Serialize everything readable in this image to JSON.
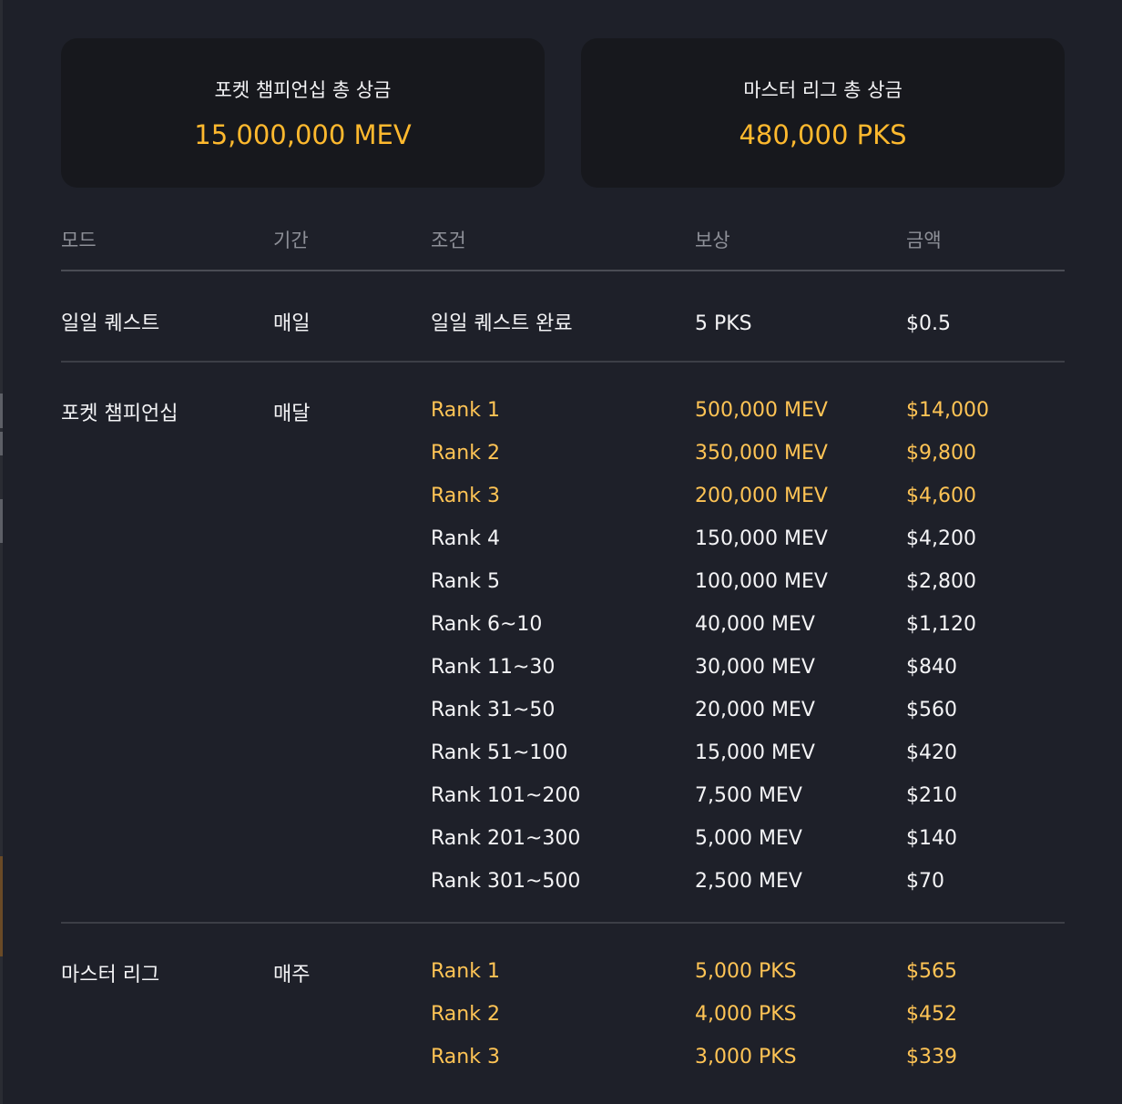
{
  "summary": {
    "cards": [
      {
        "title": "포켓 챔피언십 총 상금",
        "value": "15,000,000 MEV"
      },
      {
        "title": "마스터 리그 총 상금",
        "value": "480,000 PKS"
      }
    ]
  },
  "table": {
    "headers": {
      "mode": "모드",
      "period": "기간",
      "condition": "조건",
      "reward": "보상",
      "amount": "금액"
    },
    "groups": [
      {
        "mode": "일일 퀘스트",
        "period": "매일",
        "rows": [
          {
            "condition": "일일 퀘스트 완료",
            "reward": "5 PKS",
            "amount": "$0.5",
            "highlight": false
          }
        ]
      },
      {
        "mode": "포켓 챔피언십",
        "period": "매달",
        "rows": [
          {
            "condition": "Rank 1",
            "reward": "500,000 MEV",
            "amount": "$14,000",
            "highlight": true
          },
          {
            "condition": "Rank 2",
            "reward": "350,000 MEV",
            "amount": "$9,800",
            "highlight": true
          },
          {
            "condition": "Rank 3",
            "reward": "200,000 MEV",
            "amount": "$4,600",
            "highlight": true
          },
          {
            "condition": "Rank 4",
            "reward": "150,000 MEV",
            "amount": "$4,200",
            "highlight": false
          },
          {
            "condition": "Rank 5",
            "reward": "100,000 MEV",
            "amount": "$2,800",
            "highlight": false
          },
          {
            "condition": "Rank 6~10",
            "reward": "40,000 MEV",
            "amount": "$1,120",
            "highlight": false
          },
          {
            "condition": "Rank 11~30",
            "reward": "30,000 MEV",
            "amount": "$840",
            "highlight": false
          },
          {
            "condition": "Rank 31~50",
            "reward": "20,000 MEV",
            "amount": "$560",
            "highlight": false
          },
          {
            "condition": "Rank 51~100",
            "reward": "15,000 MEV",
            "amount": "$420",
            "highlight": false
          },
          {
            "condition": "Rank 101~200",
            "reward": "7,500 MEV",
            "amount": "$210",
            "highlight": false
          },
          {
            "condition": "Rank 201~300",
            "reward": "5,000 MEV",
            "amount": "$140",
            "highlight": false
          },
          {
            "condition": "Rank 301~500",
            "reward": "2,500 MEV",
            "amount": "$70",
            "highlight": false
          }
        ]
      },
      {
        "mode": "마스터 리그",
        "period": "매주",
        "rows": [
          {
            "condition": "Rank 1",
            "reward": "5,000 PKS",
            "amount": "$565",
            "highlight": true
          },
          {
            "condition": "Rank 2",
            "reward": "4,000 PKS",
            "amount": "$452",
            "highlight": true
          },
          {
            "condition": "Rank 3",
            "reward": "3,000 PKS",
            "amount": "$339",
            "highlight": true
          }
        ]
      }
    ]
  },
  "colors": {
    "background": "#1e2029",
    "card_background": "#17181d",
    "accent_gold": "#ffb92e",
    "highlight_text": "#ffc455",
    "header_text": "#8e9098",
    "body_text": "#f4f4f6",
    "divider": "#3c3e46"
  }
}
